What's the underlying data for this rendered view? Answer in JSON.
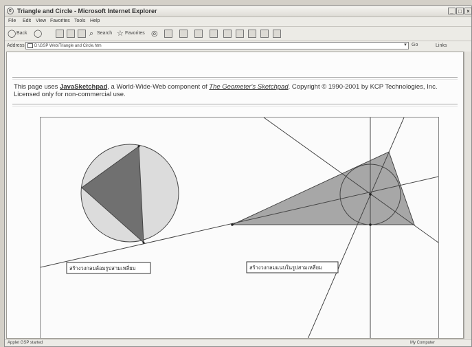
{
  "window": {
    "title": "Triangle and Circle - Microsoft Internet Explorer",
    "controls": [
      "_",
      "□",
      "×"
    ]
  },
  "menu": [
    "File",
    "Edit",
    "View",
    "Favorites",
    "Tools",
    "Help"
  ],
  "toolbar": {
    "back": "Back",
    "search": "Search",
    "favorites": "Favorites"
  },
  "address": {
    "label": "Address",
    "value": "D:\\GSP Web\\Triangle and Circle.htm",
    "go": "Go",
    "links": "Links"
  },
  "notice": {
    "prefix": "This page uses ",
    "jsp": "JavaSketchpad",
    "middle": ", a World-Wide-Web component of ",
    "gsp": "The Geometer's Sketchpad",
    "suffix": ". Copyright © 1990-2001 by KCP Technologies, Inc. Licensed only for non-commercial use."
  },
  "sketch": {
    "button_left": "สร้างวงกลมล้อมรูปสามเหลี่ยม",
    "button_right": "สร้างวงกลมแนบในรูปสามเหลี่ยม",
    "circle_fill": "#dcdcdc",
    "triangle_left_fill": "#707070",
    "triangle_right_fill": "#a7a7a7",
    "line_color": "#444444"
  },
  "status": {
    "left": "Applet GSP started",
    "right": "My Computer"
  }
}
